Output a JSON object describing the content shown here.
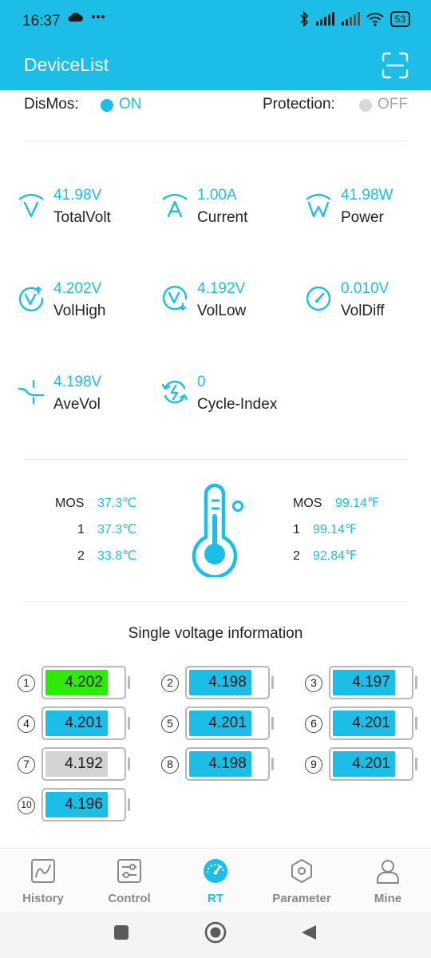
{
  "status_bar": {
    "time": "16:37",
    "battery": "53"
  },
  "app_bar": {
    "title": "DeviceList"
  },
  "switches": {
    "dismos_label": "DisMos:",
    "dismos_state": "ON",
    "protection_label": "Protection:",
    "protection_state": "OFF"
  },
  "metrics": [
    {
      "value": "41.98V",
      "label": "TotalVolt",
      "icon": "voltage-icon"
    },
    {
      "value": "1.00A",
      "label": "Current",
      "icon": "current-icon"
    },
    {
      "value": "41.98W",
      "label": "Power",
      "icon": "power-icon"
    },
    {
      "value": "4.202V",
      "label": "VolHigh",
      "icon": "volt-high-icon"
    },
    {
      "value": "4.192V",
      "label": "VolLow",
      "icon": "volt-low-icon"
    },
    {
      "value": "0.010V",
      "label": "VolDiff",
      "icon": "gauge-icon"
    },
    {
      "value": "4.198V",
      "label": "AveVol",
      "icon": "average-icon"
    },
    {
      "value": "0",
      "label": "Cycle-Index",
      "icon": "cycle-icon"
    }
  ],
  "temperatures": {
    "celsius": [
      {
        "name": "MOS",
        "value": "37.3℃"
      },
      {
        "name": "1",
        "value": "37.3℃"
      },
      {
        "name": "2",
        "value": "33.8℃"
      }
    ],
    "fahrenheit": [
      {
        "name": "MOS",
        "value": "99.14℉"
      },
      {
        "name": "1",
        "value": "99.14℉"
      },
      {
        "name": "2",
        "value": "92.84℉"
      }
    ]
  },
  "cells": {
    "title": "Single voltage information",
    "items": [
      {
        "index": "1",
        "voltage": "4.202",
        "status": "high"
      },
      {
        "index": "2",
        "voltage": "4.198",
        "status": "normal"
      },
      {
        "index": "3",
        "voltage": "4.197",
        "status": "normal"
      },
      {
        "index": "4",
        "voltage": "4.201",
        "status": "normal"
      },
      {
        "index": "5",
        "voltage": "4.201",
        "status": "normal"
      },
      {
        "index": "6",
        "voltage": "4.201",
        "status": "normal"
      },
      {
        "index": "7",
        "voltage": "4.192",
        "status": "low"
      },
      {
        "index": "8",
        "voltage": "4.198",
        "status": "normal"
      },
      {
        "index": "9",
        "voltage": "4.201",
        "status": "normal"
      },
      {
        "index": "10",
        "voltage": "4.196",
        "status": "normal"
      }
    ]
  },
  "bottom_nav": [
    {
      "label": "History",
      "icon": "history-chart-icon",
      "active": false
    },
    {
      "label": "Control",
      "icon": "control-sliders-icon",
      "active": false
    },
    {
      "label": "RT",
      "icon": "realtime-gauge-icon",
      "active": true
    },
    {
      "label": "Parameter",
      "icon": "parameter-hexagon-icon",
      "active": false
    },
    {
      "label": "Mine",
      "icon": "user-icon",
      "active": false
    }
  ],
  "colors": {
    "accent": "#1cbde6",
    "on_dot": "#1cbde6",
    "off_dot": "#d9d9d9",
    "off_text": "#a9a9a9",
    "cell_normal": "#1cbde6",
    "cell_high": "#2ee90b",
    "cell_low": "#d3d3d3"
  }
}
